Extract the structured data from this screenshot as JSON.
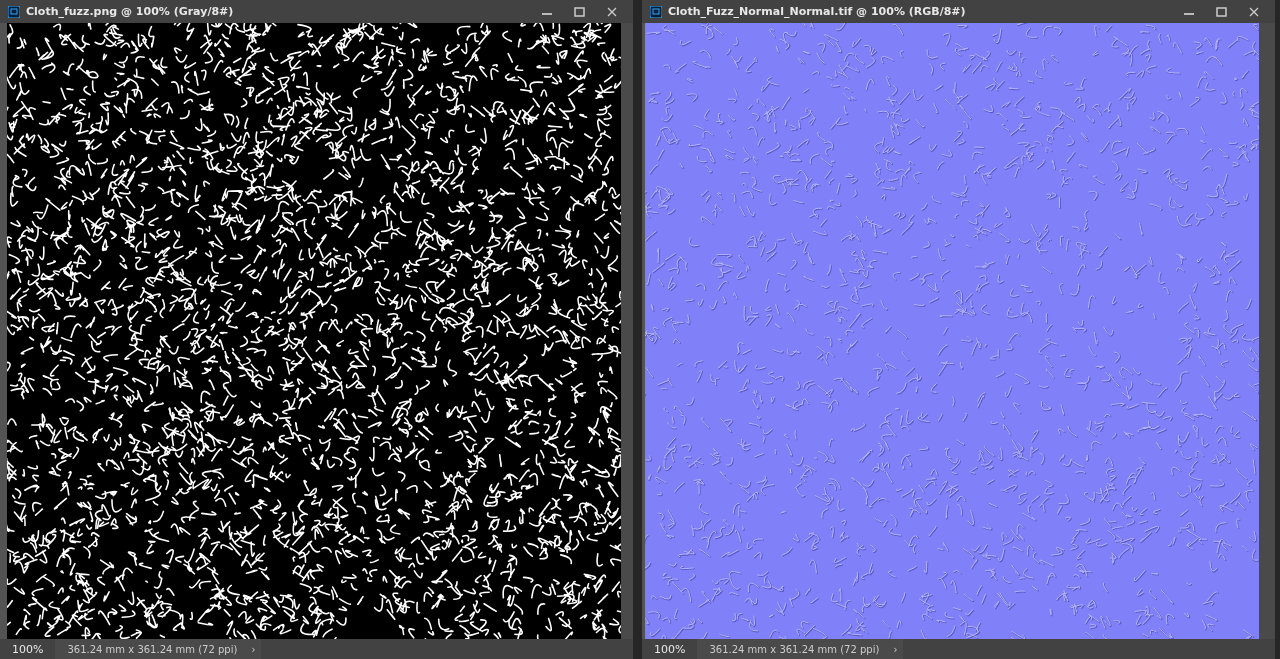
{
  "windows": [
    {
      "title": "Cloth_fuzz.png @ 100% (Gray/8#)",
      "kind": "grayscale",
      "zoom": "100%",
      "doc_info": "361.24 mm x 361.24 mm (72 ppi)",
      "status_arrow": "›"
    },
    {
      "title": "Cloth_Fuzz_Normal_Normal.tif @ 100% (RGB/8#)",
      "kind": "normal",
      "zoom": "100%",
      "doc_info": "361.24 mm x 361.24 mm (72 ppi)",
      "status_arrow": "›"
    }
  ]
}
